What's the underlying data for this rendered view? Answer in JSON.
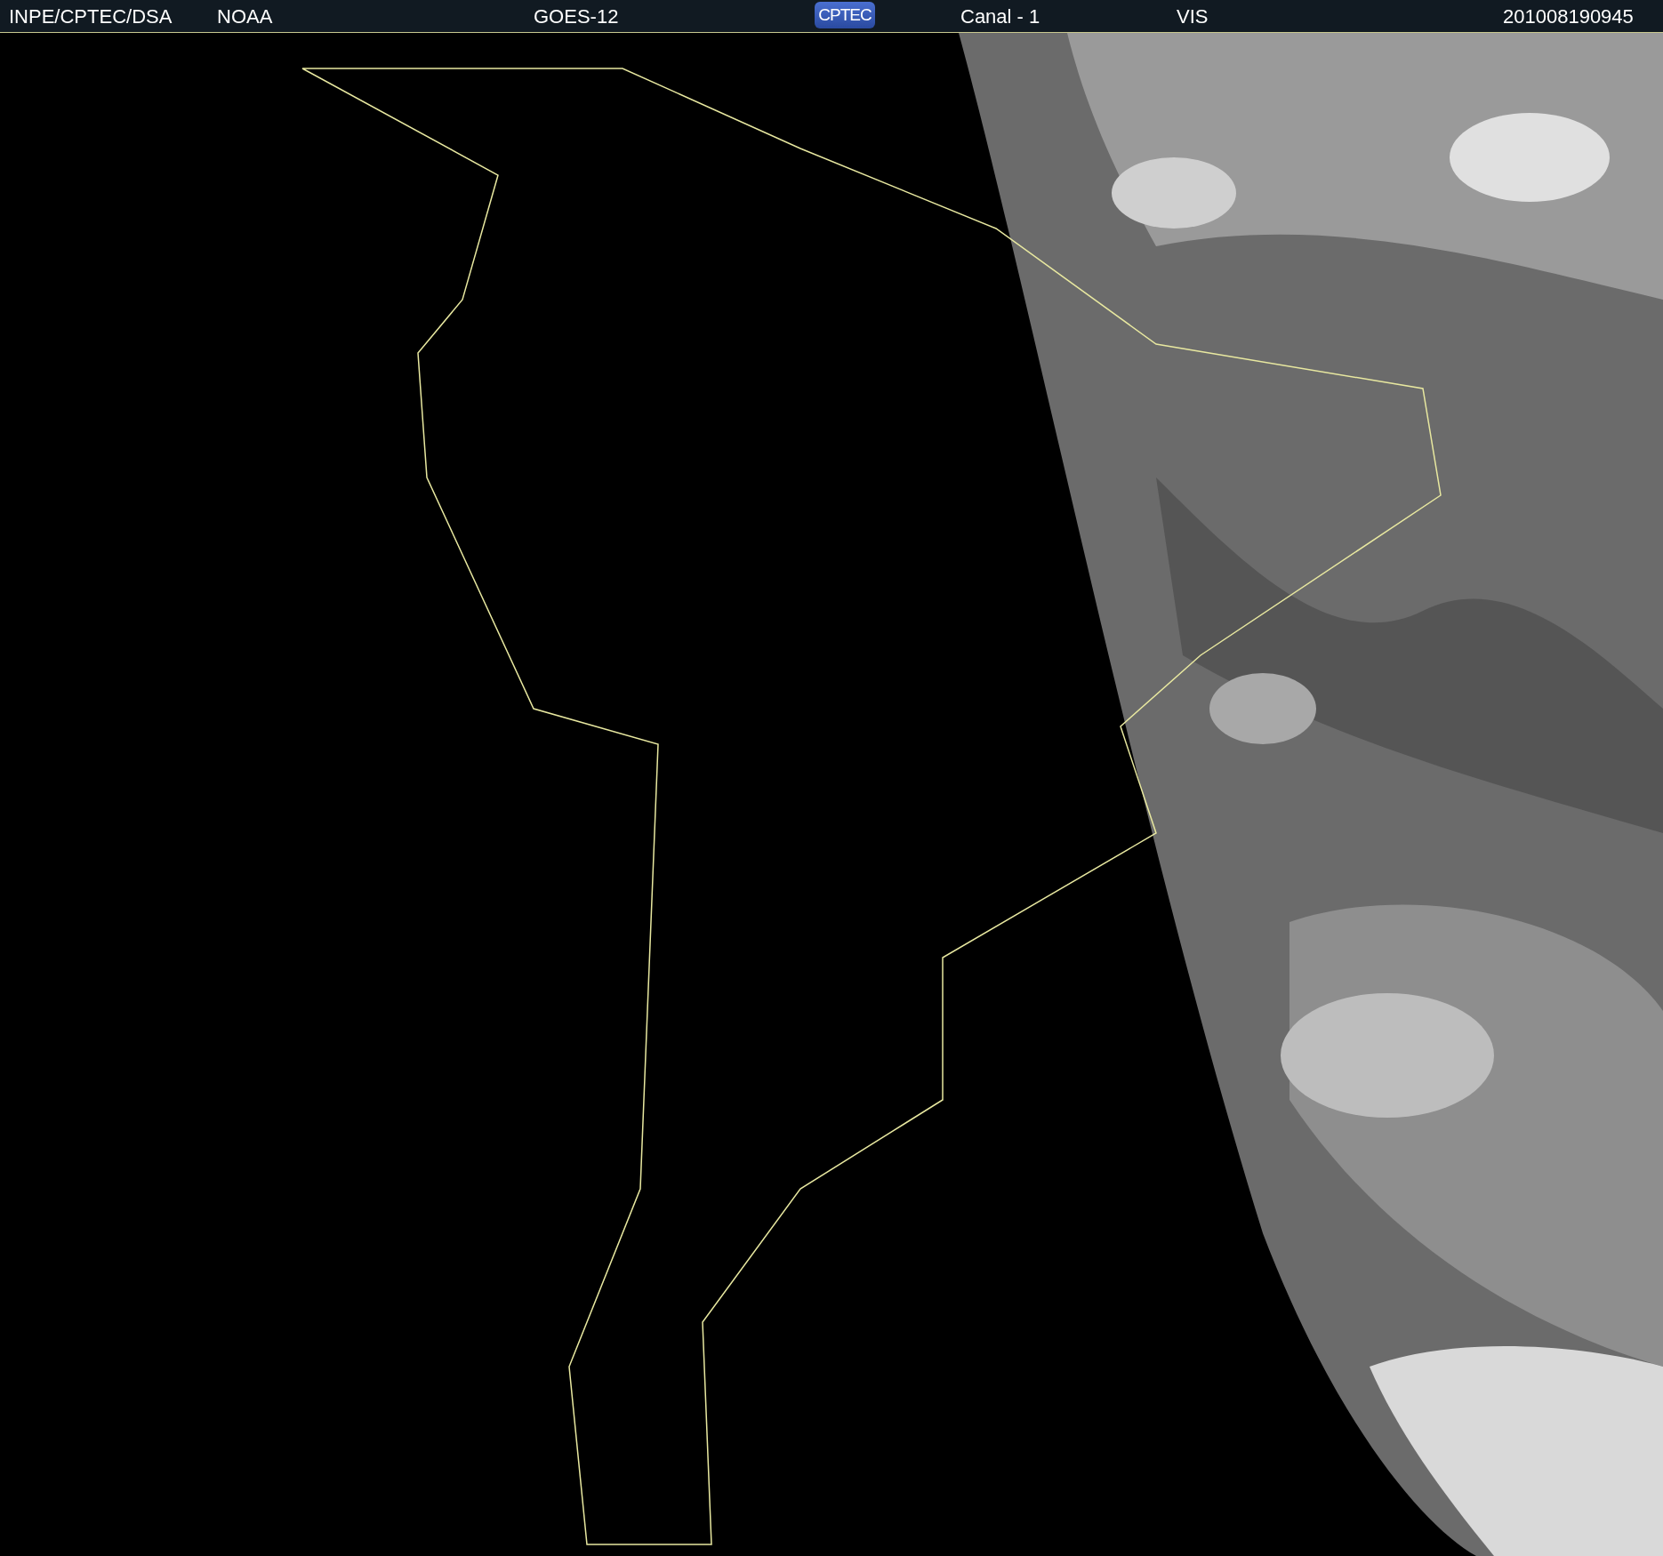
{
  "header": {
    "items": [
      {
        "kind": "text",
        "text": "INPE/CPTEC/DSA"
      },
      {
        "kind": "text",
        "text": "NOAA"
      },
      {
        "kind": "text",
        "text": "GOES-12"
      },
      {
        "kind": "logo",
        "text": "CPTEC"
      },
      {
        "kind": "text",
        "text": "Canal - 1"
      },
      {
        "kind": "text",
        "text": "VIS"
      },
      {
        "kind": "text",
        "text": "201008190945"
      }
    ]
  }
}
